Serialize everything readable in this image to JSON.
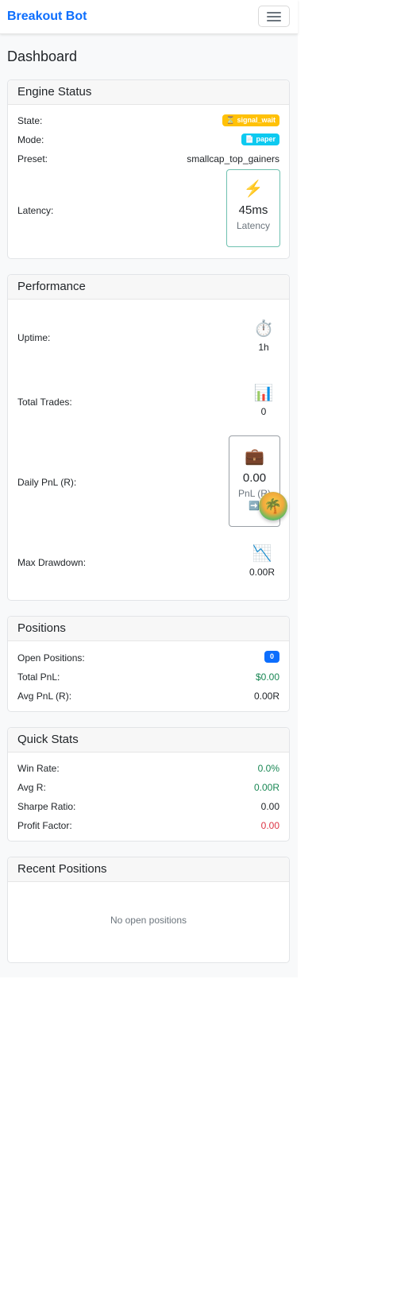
{
  "navbar": {
    "brand": "Breakout Bot",
    "menu_icon": "hamburger-menu-icon"
  },
  "page": {
    "title": "Dashboard"
  },
  "engine_status": {
    "title": "Engine Status",
    "state_label": "State:",
    "state_value": "⏳ signal_wait",
    "mode_label": "Mode:",
    "mode_value": "📄 paper",
    "preset_label": "Preset:",
    "preset_value": "smallcap_top_gainers",
    "latency_label": "Latency:",
    "latency_icon": "⚡",
    "latency_value": "45ms",
    "latency_caption": "Latency"
  },
  "performance": {
    "title": "Performance",
    "uptime_label": "Uptime:",
    "uptime_icon": "⏱️",
    "uptime_value": "1h",
    "trades_label": "Total Trades:",
    "trades_icon": "📊",
    "trades_value": "0",
    "pnl_label": "Daily PnL (R):",
    "pnl_icon": "💼",
    "pnl_value": "0.00",
    "pnl_caption": "PnL (R)",
    "pnl_arrow": "➡️",
    "drawdown_label": "Max Drawdown:",
    "drawdown_icon": "📉",
    "drawdown_value": "0.00R"
  },
  "positions": {
    "title": "Positions",
    "open_label": "Open Positions:",
    "open_value": "0",
    "total_pnl_label": "Total PnL:",
    "total_pnl_value": "$0.00",
    "avg_pnl_label": "Avg PnL (R):",
    "avg_pnl_value": "0.00R"
  },
  "quick_stats": {
    "title": "Quick Stats",
    "win_rate_label": "Win Rate:",
    "win_rate_value": "0.0%",
    "avg_r_label": "Avg R:",
    "avg_r_value": "0.00R",
    "sharpe_label": "Sharpe Ratio:",
    "sharpe_value": "0.00",
    "profit_factor_label": "Profit Factor:",
    "profit_factor_value": "0.00"
  },
  "recent_positions": {
    "title": "Recent Positions",
    "empty_text": "No open positions"
  },
  "colors": {
    "brand": "#0d6efd",
    "positive": "#198754",
    "negative": "#dc3545",
    "warning": "#ffc107",
    "info": "#0dcaf0"
  }
}
